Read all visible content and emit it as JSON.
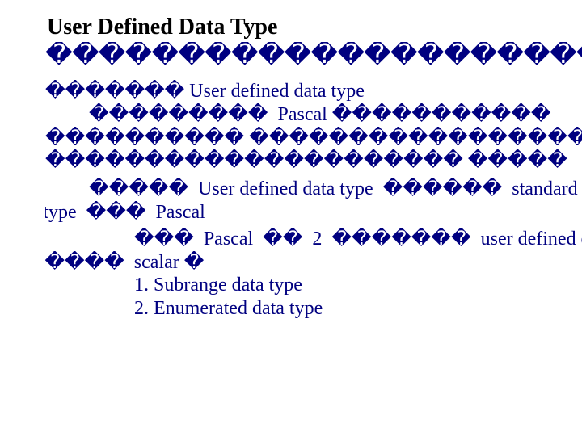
{
  "title": "User Defined Data Type",
  "glyph": "�",
  "strings": {
    "udt": "User defined data type",
    "pascal": "Pascal",
    "standard": "standard",
    "data_type": "Data type",
    "two": "2",
    "user_defined_d": "user defined d",
    "type": "type",
    "scalar": "scalar",
    "subrange": "1. Subrange data type",
    "enumerated": "2. Enumerated data type"
  }
}
